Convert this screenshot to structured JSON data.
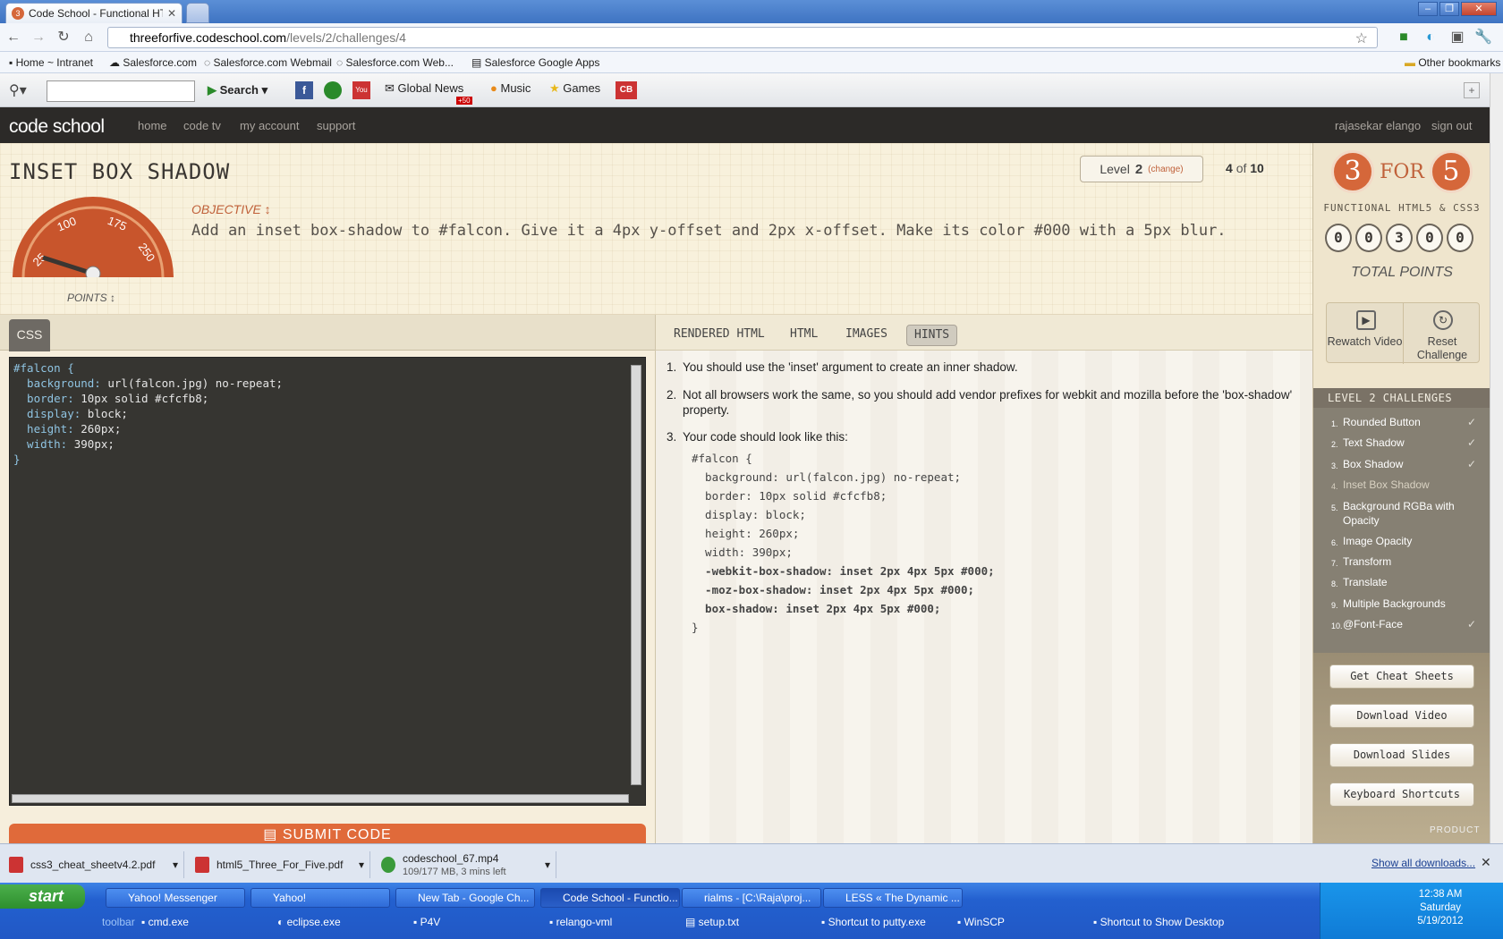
{
  "browser": {
    "tab_title": "Code School - Functional HTML",
    "url_domain": "threeforfive.codeschool.com",
    "url_path": "/levels/2/challenges/4",
    "bookmarks": [
      "Home ~ Intranet",
      "Salesforce.com",
      "Salesforce.com Webmail",
      "Salesforce.com Web...",
      "Salesforce Google Apps"
    ],
    "other_bookmarks": "Other bookmarks",
    "search_label": "Search",
    "ext_items": [
      "Global News",
      "Music",
      "Games"
    ],
    "badge": "+50"
  },
  "site": {
    "logo": "code school",
    "nav": [
      "home",
      "code tv",
      "my account",
      "support"
    ],
    "user": "rajasekar elango",
    "signout": "sign out"
  },
  "challenge": {
    "title": "INSET BOX SHADOW",
    "objective_label": "OBJECTIVE",
    "objective": "Add an inset box-shadow to #falcon. Give it a 4px y-offset and 2px x-offset. Make its color #000 with a 5px blur.",
    "points_label": "POINTS",
    "gauge_ticks": [
      "25",
      "100",
      "175",
      "250"
    ],
    "level_label": "Level",
    "level_num": "2",
    "level_change": "(change)",
    "progress_cur": "4",
    "progress_of": "of",
    "progress_total": "10"
  },
  "editor": {
    "tab": "CSS",
    "submit": "SUBMIT CODE",
    "lines": [
      {
        "p": "#falcon {",
        "v": ""
      },
      {
        "p": "  background:",
        "v": " url(falcon.jpg) no-repeat;"
      },
      {
        "p": "  border:",
        "v": " 10px solid #cfcfb8;"
      },
      {
        "p": "  display:",
        "v": " block;"
      },
      {
        "p": "  height:",
        "v": " 260px;"
      },
      {
        "p": "  width:",
        "v": " 390px;"
      },
      {
        "p": "}",
        "v": ""
      }
    ]
  },
  "panel": {
    "tabs": [
      "RENDERED HTML",
      "HTML",
      "IMAGES",
      "HINTS"
    ],
    "hints": [
      "You should use the 'inset' argument to create an inner shadow.",
      "Not all browsers work the same, so you should add vendor prefixes for webkit and mozilla before the 'box-shadow' property.",
      "Your code should look like this:"
    ],
    "hint_code": [
      "#falcon {",
      "  background: url(falcon.jpg) no-repeat;",
      "  border: 10px solid #cfcfb8;",
      "  display: block;",
      "  height: 260px;",
      "  width: 390px;",
      "  -webkit-box-shadow: inset 2px 4px 5px #000;",
      "  -moz-box-shadow: inset 2px 4px 5px #000;",
      "  box-shadow: inset 2px 4px 5px #000;",
      "}"
    ]
  },
  "sidebar": {
    "brand_3": "3",
    "brand_for": "FOR",
    "brand_5": "5",
    "brand_sub": "FUNCTIONAL HTML5 & CSS3",
    "digits": [
      "0",
      "0",
      "3",
      "0",
      "0"
    ],
    "total_points": "TOTAL POINTS",
    "rewatch": "Rewatch Video",
    "reset": "Reset Challenge",
    "level_head": "LEVEL 2 CHALLENGES",
    "challenges": [
      {
        "n": "1.",
        "t": "Rounded Button",
        "done": "✓"
      },
      {
        "n": "2.",
        "t": "Text Shadow",
        "done": "✓"
      },
      {
        "n": "3.",
        "t": "Box Shadow",
        "done": "✓"
      },
      {
        "n": "4.",
        "t": "Inset Box Shadow",
        "done": ""
      },
      {
        "n": "5.",
        "t": "Background RGBa with Opacity",
        "done": ""
      },
      {
        "n": "6.",
        "t": "Image Opacity",
        "done": ""
      },
      {
        "n": "7.",
        "t": "Transform",
        "done": ""
      },
      {
        "n": "8.",
        "t": "Translate",
        "done": ""
      },
      {
        "n": "9.",
        "t": "Multiple Backgrounds",
        "done": ""
      },
      {
        "n": "10.",
        "t": "@Font-Face",
        "done": "✓"
      }
    ],
    "buttons": [
      "Get Cheat Sheets",
      "Download Video",
      "Download Slides",
      "Keyboard Shortcuts"
    ],
    "product_text": "PRODUCT"
  },
  "downloads": {
    "items": [
      {
        "name": "css3_cheat_sheetv4.2.pdf",
        "sub": ""
      },
      {
        "name": "html5_Three_For_Five.pdf",
        "sub": ""
      },
      {
        "name": "codeschool_67.mp4",
        "sub": "109/177 MB, 3 mins left"
      }
    ],
    "show_all": "Show all downloads..."
  },
  "taskbar": {
    "start": "start",
    "tasks": [
      "Yahoo! Messenger",
      "Yahoo!",
      "New Tab - Google Ch...",
      "Code School - Functio...",
      "rialms - [C:\\Raja\\proj...",
      "LESS « The Dynamic ..."
    ],
    "quick": [
      "toolbar",
      "cmd.exe",
      "eclipse.exe",
      "P4V",
      "relango-vml",
      "setup.txt",
      "Shortcut to putty.exe",
      "WinSCP",
      "Shortcut to Show Desktop"
    ],
    "time": "12:38 AM",
    "day": "Saturday",
    "date": "5/19/2012"
  }
}
